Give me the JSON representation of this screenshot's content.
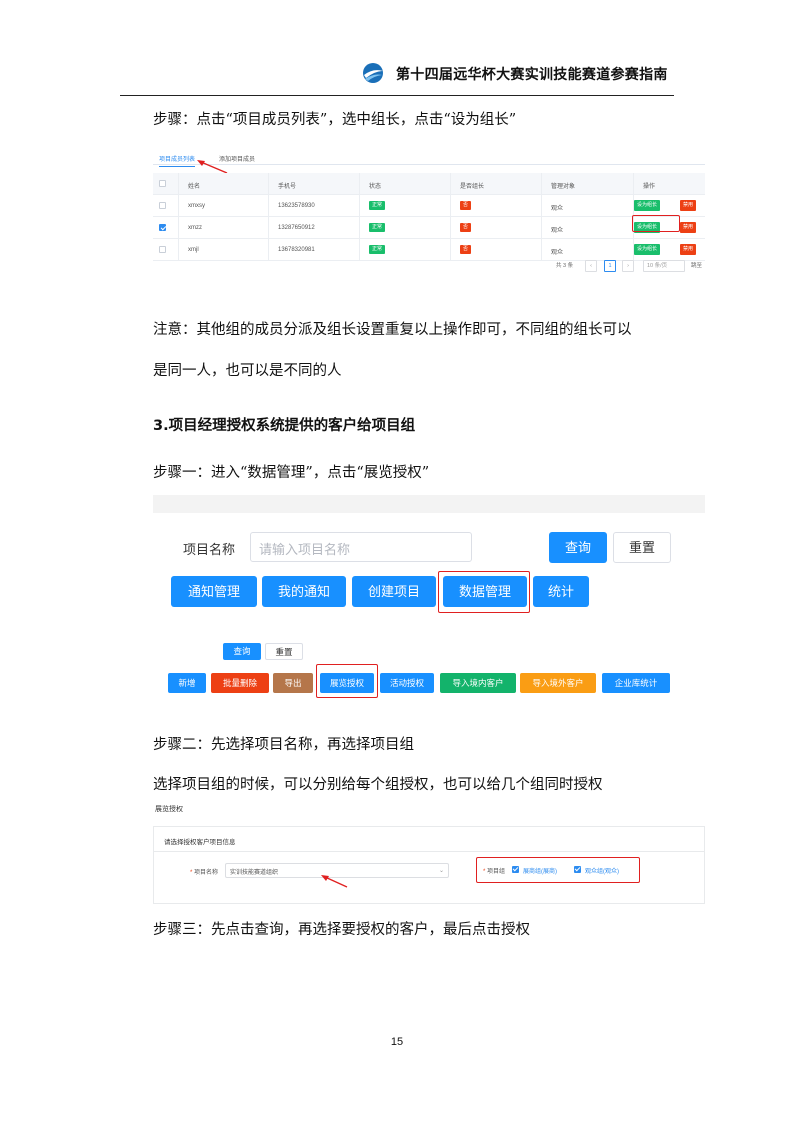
{
  "header": {
    "title": "第十四届远华杯大赛实训技能赛道参赛指南"
  },
  "paragraphs": {
    "p1": "步骤：点击“项目成员列表”，选中组长，点击“设为组长”",
    "p2": "注意：其他组的成员分派及组长设置重复以上操作即可，不同组的组长可以",
    "p3": "是同一人，也可以是不同的人",
    "h3": "3.项目经理授权系统提供的客户给项目组",
    "p4": "步骤一：进入“数据管理”，点击“展览授权”",
    "p5": "步骤二：先选择项目名称，再选择项目组",
    "p6": "选择项目组的时候，可以分别给每个组授权，也可以给几个组同时授权",
    "p7": "步骤三：先点击查询，再选择要授权的客户，最后点击授权"
  },
  "members": {
    "tabs": [
      "项目成员列表",
      "添加项目成员"
    ],
    "columns": [
      "姓名",
      "手机号",
      "状态",
      "是否组长",
      "管理对象",
      "操作"
    ],
    "rows": [
      {
        "name": "xmxsy",
        "phone": "13623578930",
        "status": "正常",
        "leader": "否",
        "target": "观众",
        "checked": false
      },
      {
        "name": "xmzz",
        "phone": "13287650912",
        "status": "正常",
        "leader": "否",
        "target": "观众",
        "checked": true
      },
      {
        "name": "xmjl",
        "phone": "13678320981",
        "status": "正常",
        "leader": "否",
        "target": "观众",
        "checked": false
      }
    ],
    "action_set": "设为组长",
    "action_disable": "禁用",
    "total": "共 3 条",
    "prev": "‹",
    "page": "1",
    "next": "›",
    "per_page": "10 条/页",
    "goto": "跳至"
  },
  "project_query": {
    "label": "项目名称",
    "placeholder": "请输入项目名称",
    "query": "查询",
    "reset": "重置",
    "nav": [
      "通知管理",
      "我的通知",
      "创建项目",
      "数据管理",
      "统计"
    ]
  },
  "data_mgmt": {
    "query": "查询",
    "reset": "重置",
    "buttons": [
      "新增",
      "批量删除",
      "导出",
      "展览授权",
      "活动授权",
      "导入境内客户",
      "导入境外客户",
      "企业库统计"
    ]
  },
  "auth": {
    "title": "展览授权",
    "panel_title": "请选择授权客户项目信息",
    "project_label": "项目名称",
    "project_value": "实训技能赛道组织",
    "group_label": "项目组",
    "groups": [
      "展商组(展商)",
      "观众组(观众)"
    ]
  },
  "colors": {
    "blue": "#1890ff",
    "green": "#19be6b",
    "red": "#ed4014",
    "brown": "#b5764a",
    "teal": "#13b36b",
    "orange": "#fa9d14",
    "highlight": "#e02020"
  },
  "page_number": "15"
}
